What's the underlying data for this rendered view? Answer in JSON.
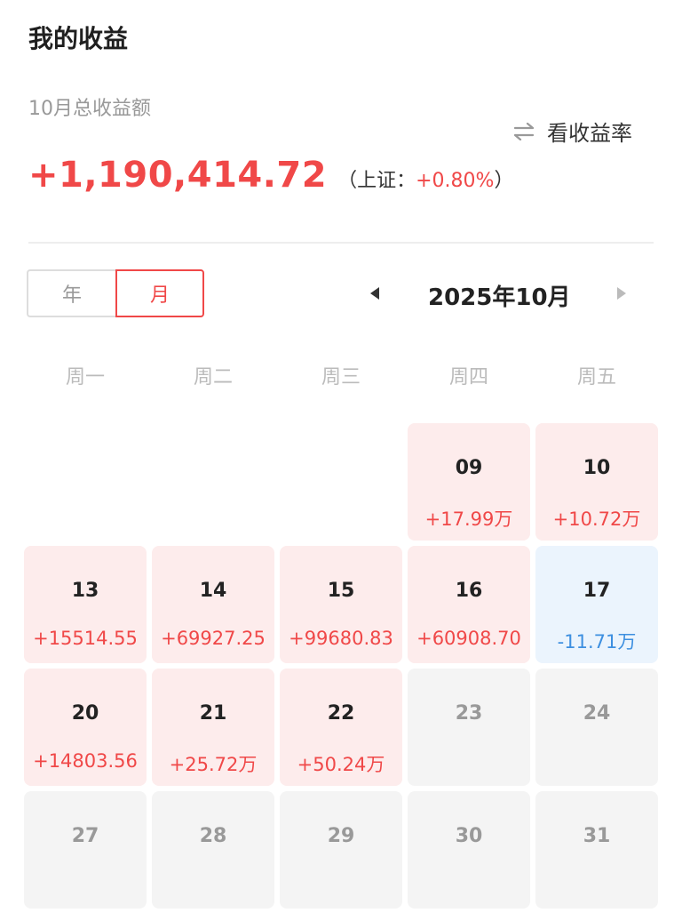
{
  "header": {
    "title": "我的收益",
    "sub_label": "10月总收益额",
    "switch_label": "看收益率",
    "switch_icon": "swap-arrows-icon"
  },
  "summary": {
    "amount": "+1,190,414.72",
    "bench_open": "（上证：",
    "bench_pct": "+0.80%",
    "bench_close": "）"
  },
  "toggle": {
    "year": "年",
    "month": "月",
    "selected": "月"
  },
  "month_nav": {
    "label": "2025年10月",
    "prev_icon": "caret-left-icon",
    "next_icon": "caret-right-icon"
  },
  "weekdays": [
    "周一",
    "周二",
    "周三",
    "周四",
    "周五"
  ],
  "colors": {
    "gain": "#f04848",
    "loss": "#3d8fe0",
    "gain_bg": "#fdecec",
    "loss_bg": "#ebf4fd",
    "none_bg": "#f4f4f4"
  },
  "calendar": {
    "weeks": [
      [
        {
          "day": "",
          "value": "",
          "status": "empty"
        },
        {
          "day": "",
          "value": "",
          "status": "empty"
        },
        {
          "day": "",
          "value": "",
          "status": "empty"
        },
        {
          "day": "09",
          "value": "+17.99万",
          "status": "gain"
        },
        {
          "day": "10",
          "value": "+10.72万",
          "status": "gain"
        }
      ],
      [
        {
          "day": "13",
          "value": "+15514.55",
          "status": "gain"
        },
        {
          "day": "14",
          "value": "+69927.25",
          "status": "gain"
        },
        {
          "day": "15",
          "value": "+99680.83",
          "status": "gain"
        },
        {
          "day": "16",
          "value": "+60908.70",
          "status": "gain"
        },
        {
          "day": "17",
          "value": "-11.71万",
          "status": "loss"
        }
      ],
      [
        {
          "day": "20",
          "value": "+14803.56",
          "status": "gain"
        },
        {
          "day": "21",
          "value": "+25.72万",
          "status": "gain"
        },
        {
          "day": "22",
          "value": "+50.24万",
          "status": "gain"
        },
        {
          "day": "23",
          "value": "",
          "status": "none"
        },
        {
          "day": "24",
          "value": "",
          "status": "none"
        }
      ],
      [
        {
          "day": "27",
          "value": "",
          "status": "none"
        },
        {
          "day": "28",
          "value": "",
          "status": "none"
        },
        {
          "day": "29",
          "value": "",
          "status": "none"
        },
        {
          "day": "30",
          "value": "",
          "status": "none"
        },
        {
          "day": "31",
          "value": "",
          "status": "none"
        }
      ]
    ]
  }
}
